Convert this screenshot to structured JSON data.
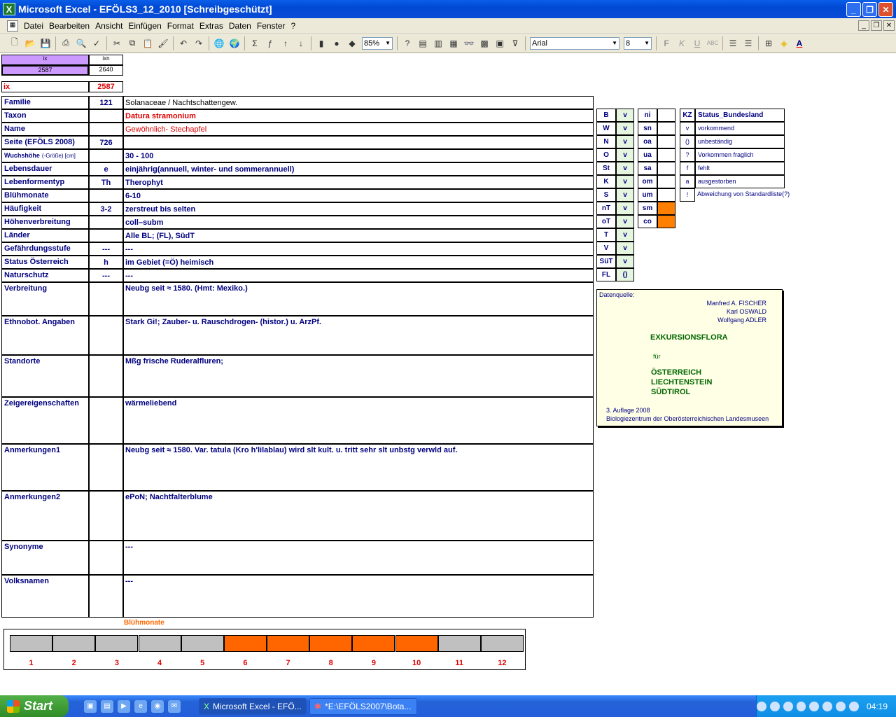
{
  "window": {
    "title": "Microsoft Excel - EFÖLS3_12_2010  [Schreibgeschützt]",
    "app_icon": "excel-icon"
  },
  "menu": [
    "Datei",
    "Bearbeiten",
    "Ansicht",
    "Einfügen",
    "Format",
    "Extras",
    "Daten",
    "Fenster",
    "?"
  ],
  "toolbar": {
    "zoom": "85%",
    "font": "Arial",
    "size": "8"
  },
  "index": {
    "ix_label": "ix",
    "ixn_label": "ixn",
    "ix_value": "2587",
    "ixn_value": "2640",
    "ix_row_label": "ix",
    "ix_row_value": "2587"
  },
  "rows": [
    {
      "label": "Familie",
      "code": "121",
      "value": "Solanaceae  /  Nachtschattengew."
    },
    {
      "label": "Taxon",
      "code": "",
      "value": "Datura stramonium"
    },
    {
      "label": "Name",
      "code": "",
      "value": "Gewöhnlich- Stechapfel"
    },
    {
      "label": "Seite (EFÖLS 2008)",
      "code": "726",
      "value": ""
    },
    {
      "label": "Wuchshöhe",
      "label_suffix": "(-Größe) [cm]",
      "code": "",
      "value": " 30 - 100"
    },
    {
      "label": "Lebensdauer",
      "code": "e",
      "value": "einjährig(annuell, winter- und sommerannuell)"
    },
    {
      "label": "Lebenformentyp",
      "code": "Th",
      "value": "Therophyt"
    },
    {
      "label": "Blühmonate",
      "code": "",
      "value": " 6-10"
    },
    {
      "label": "Häufigkeit",
      "code": "3-2",
      "value": "zerstreut bis selten"
    },
    {
      "label": "Höhenverbreitung",
      "code": "",
      "value": "coll–subm"
    },
    {
      "label": "Länder",
      "code": "",
      "value": "Alle BL; (FL), SüdT"
    },
    {
      "label": "Gefährdungsstufe",
      "code": "---",
      "value": "  ---"
    },
    {
      "label": "Status Österreich",
      "code": "h",
      "value": "im Gebiet (=Ö) heimisch"
    },
    {
      "label": "Naturschutz",
      "code": "---",
      "value": "---"
    }
  ],
  "big_rows": [
    {
      "label": "Verbreitung",
      "value": "Neubg seit ≈ 1580. (Hmt: Mexiko.)"
    },
    {
      "label": "Ethnobot. Angaben",
      "value": "Stark Gi!; Zauber- u. Rauschdrogen- (histor.) u. ArzPf."
    },
    {
      "label": "Standorte",
      "value": "Mßg frische Ruderalfluren;"
    },
    {
      "label": "Zeigereigenschaften",
      "value": "wärmeliebend"
    },
    {
      "label": "Anmerkungen1",
      "value": "Neubg seit ≈ 1580. Var. tatula (Kro h'lilablau) wird slt kult. u. tritt sehr slt unbstg verwld auf."
    },
    {
      "label": "Anmerkungen2",
      "value": "ePoN; Nachtfalterblume"
    },
    {
      "label": "Synonyme",
      "value": "---"
    },
    {
      "label": "Volksnamen",
      "value": "---"
    }
  ],
  "states": [
    {
      "code": "B",
      "v": "v"
    },
    {
      "code": "W",
      "v": "v"
    },
    {
      "code": "N",
      "v": "v"
    },
    {
      "code": "O",
      "v": "v"
    },
    {
      "code": "St",
      "v": "v"
    },
    {
      "code": "K",
      "v": "v"
    },
    {
      "code": "S",
      "v": "v"
    },
    {
      "code": "nT",
      "v": "v"
    },
    {
      "code": "oT",
      "v": "v"
    },
    {
      "code": "T",
      "v": "v"
    },
    {
      "code": "V",
      "v": "v"
    },
    {
      "code": "SüT",
      "v": "v"
    },
    {
      "code": "FL",
      "v": "()"
    }
  ],
  "zones": [
    {
      "code": "ni",
      "on": false
    },
    {
      "code": "sn",
      "on": false
    },
    {
      "code": "oa",
      "on": false
    },
    {
      "code": "ua",
      "on": false
    },
    {
      "code": "sa",
      "on": false
    },
    {
      "code": "om",
      "on": false
    },
    {
      "code": "um",
      "on": false
    },
    {
      "code": "sm",
      "on": true
    },
    {
      "code": "co",
      "on": true
    }
  ],
  "status_legend": {
    "header_code": "KZ",
    "header_label": "Status_Bundesland",
    "items": [
      {
        "code": "v",
        "label": "vorkommend"
      },
      {
        "code": "()",
        "label": "unbeständig"
      },
      {
        "code": "?",
        "label": "Vorkommen fraglich"
      },
      {
        "code": "f",
        "label": "fehlt"
      },
      {
        "code": "a",
        "label": "ausgestorben"
      },
      {
        "code": "!",
        "label": "Abweichung von Standardliste(?)"
      }
    ]
  },
  "source": {
    "heading": "Datenquelle:",
    "authors": [
      "Manfred A. FISCHER",
      "Karl OSWALD",
      "Wolfgang ADLER"
    ],
    "title": "EXKURSIONSFLORA",
    "for": "für",
    "countries": [
      "ÖSTERREICH",
      "LIECHTENSTEIN",
      "SÜDTIROL"
    ],
    "edition": "3. Auflage 2008",
    "publisher": "Biologiezentrum der Oberösterreichischen Landesmuseen"
  },
  "bloom": {
    "title": "Blühmonate",
    "months": [
      "1",
      "2",
      "3",
      "4",
      "5",
      "6",
      "7",
      "8",
      "9",
      "10",
      "11",
      "12"
    ],
    "active": [
      false,
      false,
      false,
      false,
      false,
      true,
      true,
      true,
      true,
      true,
      false,
      false
    ],
    "active_color": "#ff6600",
    "inactive_color": "#c0c0c0"
  },
  "taskbar": {
    "start": "Start",
    "tasks": [
      "Microsoft Excel - EFÖ...",
      "*E:\\EFÖLS2007\\Bota..."
    ],
    "clock": "04:19"
  }
}
